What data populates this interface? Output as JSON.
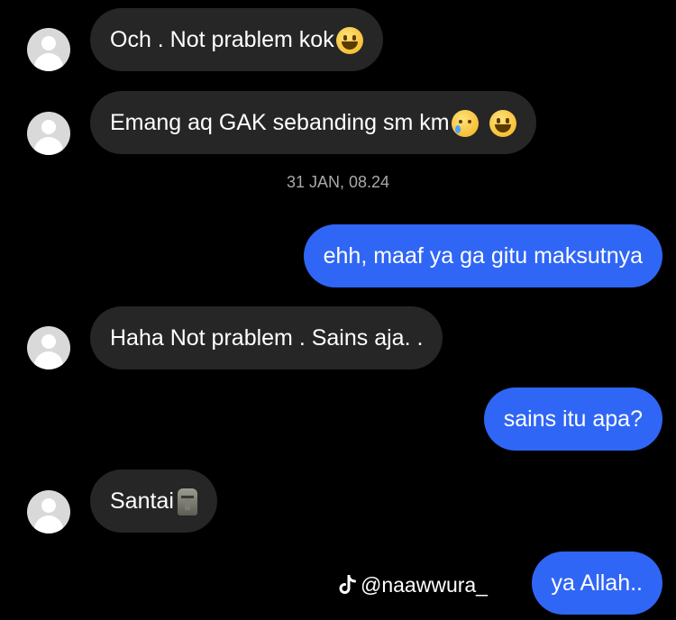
{
  "chat": {
    "messages": [
      {
        "side": "in",
        "text": "Och . Not prablem kok"
      },
      {
        "side": "in",
        "text": "Emang aq GAK sebanding sm km"
      },
      {
        "side": "out",
        "text": "ehh, maaf ya ga gitu maksutnya"
      },
      {
        "side": "in",
        "text": "Haha Not prablem . Sains aja. ."
      },
      {
        "side": "out",
        "text": "sains itu apa?"
      },
      {
        "side": "in",
        "text": "Santai"
      },
      {
        "side": "out",
        "text": "ya Allah.."
      }
    ],
    "timestamp": "31 JAN, 08.24"
  },
  "icons": {
    "grinning_emoji": "grinning-face-emoji",
    "crying_emoji": "crying-face-emoji",
    "moai_emoji": "moai-emoji",
    "avatar": "default-avatar-icon",
    "tiktok": "tiktok-logo-icon"
  },
  "colors": {
    "background": "#000000",
    "incoming_bubble": "#262626",
    "outgoing_bubble": "#2f66f5",
    "timestamp": "#a8a8a8"
  },
  "watermark": {
    "handle": "@naawwura_"
  }
}
